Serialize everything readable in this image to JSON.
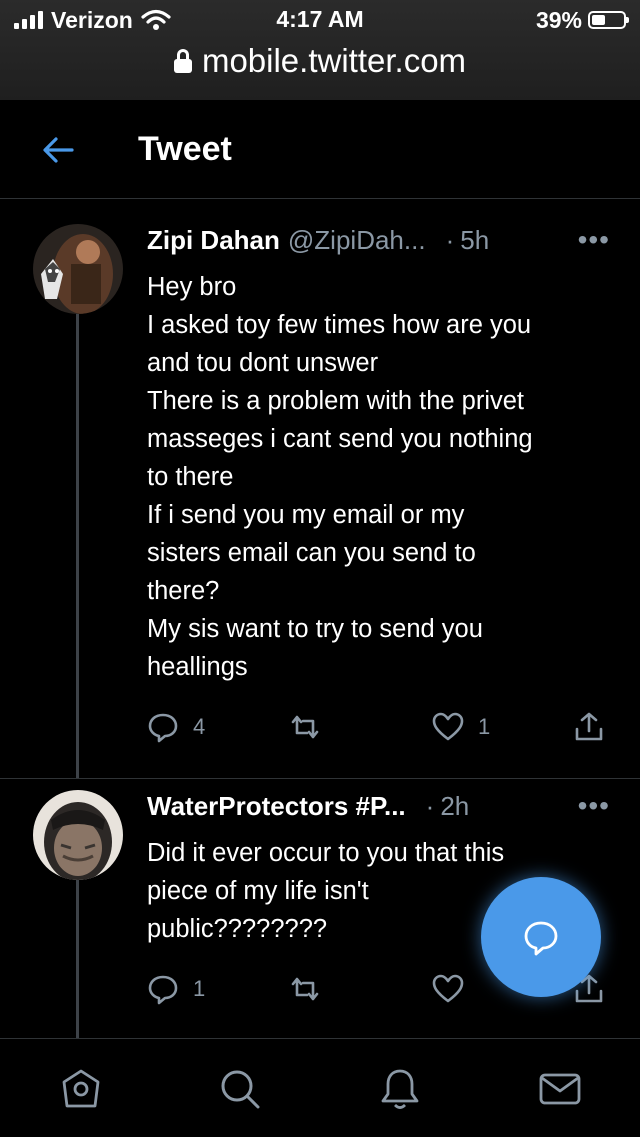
{
  "status_bar": {
    "carrier": "Verizon",
    "time": "4:17 AM",
    "battery": "39%",
    "battery_level": 0.39
  },
  "url_bar": {
    "domain": "mobile.twitter.com"
  },
  "header": {
    "title": "Tweet"
  },
  "tweets": [
    {
      "name": "Zipi Dahan",
      "handle": "@ZipiDah...",
      "dot": "·",
      "time": "5h",
      "more": "•••",
      "lines": [
        "Hey bro",
        "I asked toy few  times how are you",
        "and tou dont unswer",
        "There is a problem with the  privet",
        "masseges i cant send you nothing",
        "to there",
        "If i send you my email or my",
        "sisters email can you send to",
        "there?",
        "My sis want to try to send you",
        "heallings"
      ],
      "reply_count": "4",
      "like_count": "1"
    },
    {
      "name": "WaterProtectors #P...",
      "handle": "",
      "dot": "·",
      "time": "2h",
      "more": "•••",
      "lines": [
        "Did it ever occur to you that  this",
        "piece of my life isn't",
        "public????????"
      ],
      "reply_count": "1",
      "like_count": ""
    }
  ],
  "icons": {
    "back": "arrow-left-icon",
    "reply": "reply-icon",
    "retweet": "retweet-icon",
    "like": "heart-icon",
    "share": "share-icon",
    "compose": "compose-reply-icon",
    "nav": [
      "home-icon",
      "search-icon",
      "notifications-icon",
      "messages-icon"
    ]
  },
  "colors": {
    "accent": "#4a99e9",
    "muted": "#8b98a5",
    "background": "#000000"
  }
}
